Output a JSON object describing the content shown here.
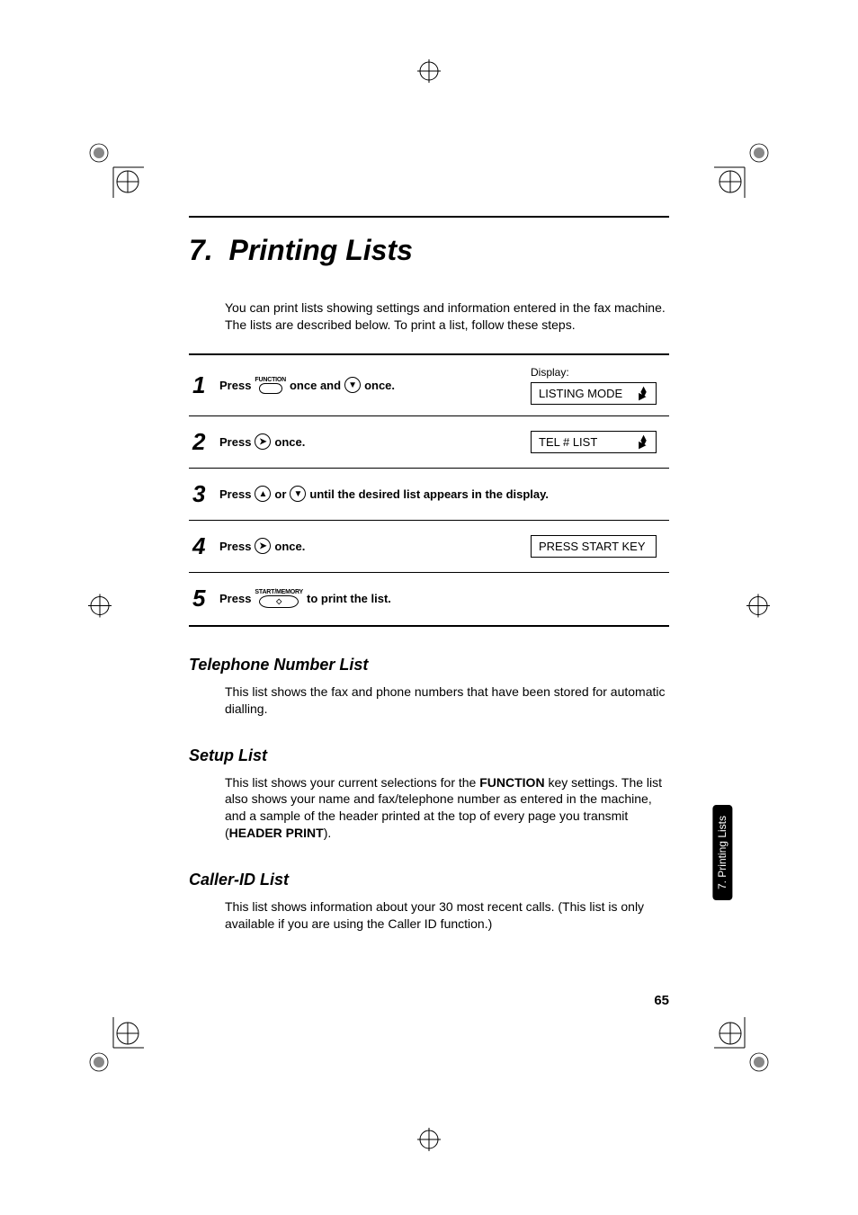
{
  "chapter": {
    "number": "7.",
    "title": "Printing Lists"
  },
  "intro": "You can print lists showing settings and information entered in the fax machine. The lists are described below. To print a list, follow these steps.",
  "display_label": "Display:",
  "steps": [
    {
      "num": "1",
      "pre": "Press",
      "btn_label": "FUNCTION",
      "mid": " once and ",
      "post": " once.",
      "lcd": "LISTING MODE",
      "lcd_arrows": true
    },
    {
      "num": "2",
      "pre": "Press",
      "post": " once.",
      "lcd": "TEL # LIST",
      "lcd_arrows": true
    },
    {
      "num": "3",
      "pre": "Press",
      "mid": " or ",
      "post": " until the desired list appears in the display."
    },
    {
      "num": "4",
      "pre": "Press",
      "post": " once.",
      "lcd": "PRESS START KEY"
    },
    {
      "num": "5",
      "pre": "Press",
      "btn_label": "START/MEMORY",
      "post": " to print the list."
    }
  ],
  "sections": [
    {
      "heading": "Telephone Number List",
      "body": "This list shows the fax and phone numbers that have been stored for automatic dialling."
    },
    {
      "heading": "Setup List",
      "body_pre": "This list shows your current selections for the ",
      "body_bold1": "FUNCTION",
      "body_mid": " key settings. The list also shows your name and fax/telephone number as entered in the machine, and a sample of the header printed at the top of every page you transmit (",
      "body_bold2": "HEADER PRINT",
      "body_post": ")."
    },
    {
      "heading": "Caller-ID List",
      "body": "This list shows information about your 30 most recent calls. (This list is only available if you are using the Caller ID function.)"
    }
  ],
  "tab": "7. Printing Lists",
  "page_number": "65"
}
